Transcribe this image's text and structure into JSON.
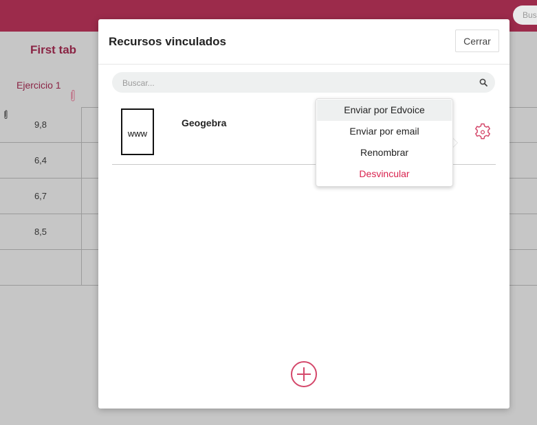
{
  "app": {
    "top_search_placeholder": "Bus",
    "tab_title": "First tab",
    "column_header": "Ejercicio 1",
    "grades": [
      "9,8",
      "6,4",
      "6,7",
      "8,5",
      ""
    ]
  },
  "modal": {
    "title": "Recursos vinculados",
    "close_label": "Cerrar",
    "search_placeholder": "Buscar...",
    "resources": [
      {
        "name": "Geogebra",
        "icon_text": "www",
        "icon": "www-document-icon"
      }
    ]
  },
  "context_menu": {
    "items": [
      {
        "label": "Enviar por Edvoice"
      },
      {
        "label": "Enviar por email"
      },
      {
        "label": "Renombrar"
      },
      {
        "label": "Desvincular"
      }
    ]
  },
  "colors": {
    "brand": "#9c2b4b",
    "accent": "#d9214d",
    "icon_accent": "#d4476a"
  }
}
